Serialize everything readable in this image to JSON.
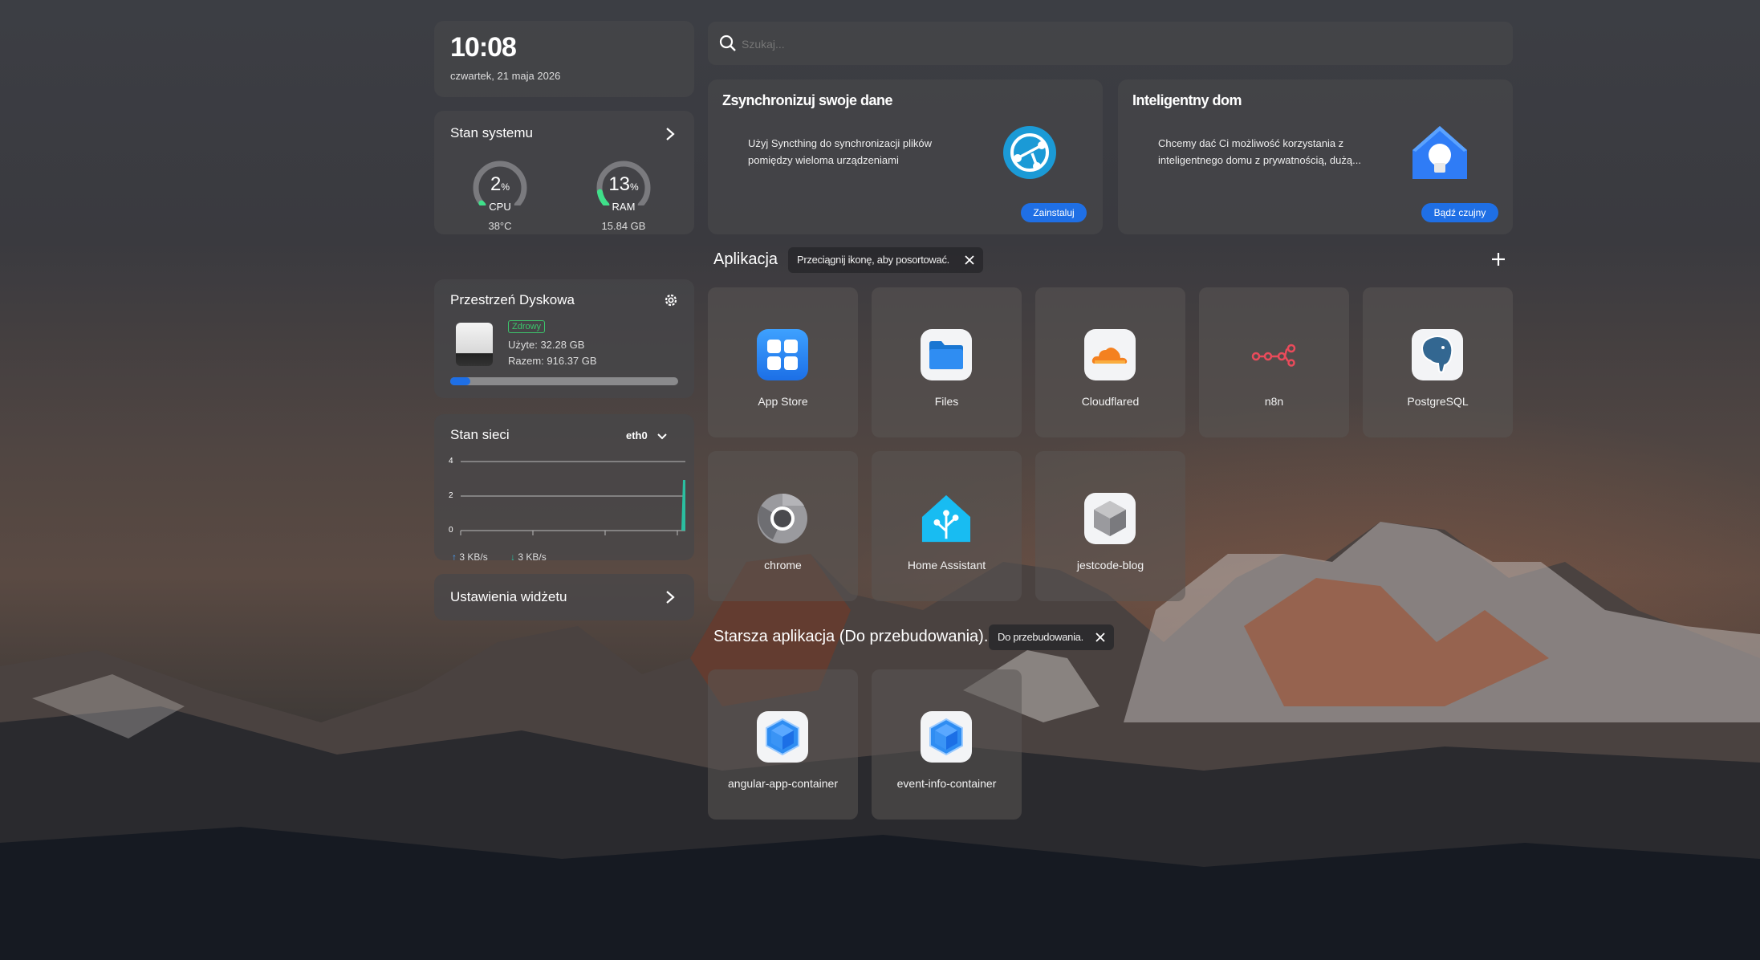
{
  "clock": {
    "time": "10:08",
    "date": "czwartek, 21 maja 2026"
  },
  "system": {
    "title": "Stan systemu",
    "cpu": {
      "value": "2",
      "unit": "%",
      "label": "CPU",
      "sub": "38°C",
      "level": 0.02
    },
    "ram": {
      "value": "13",
      "unit": "%",
      "label": "RAM",
      "sub": "15.84 GB",
      "level": 0.13
    }
  },
  "disk": {
    "title": "Przestrzeń Dyskowa",
    "status": "Zdrowy",
    "used": "Użyte: 32.28 GB",
    "total": "Razem: 916.37 GB",
    "usage": 0.035
  },
  "network": {
    "title": "Stan sieci",
    "interface": "eth0",
    "ticks": [
      "4",
      "2",
      "0"
    ],
    "upload": "3 KB/s",
    "download": "3 KB/s"
  },
  "widget_settings": {
    "label": "Ustawienia widżetu"
  },
  "search": {
    "placeholder": "Szukaj..."
  },
  "promo": [
    {
      "title": "Zsynchronizuj swoje dane",
      "text1": "Użyj Syncthing do synchronizacji plików",
      "text2": "pomiędzy wieloma urządzeniami",
      "button": "Zainstaluj"
    },
    {
      "title": "Inteligentny dom",
      "text1": "Chcemy dać Ci możliwość korzystania z",
      "text2": "inteligentnego domu z prywatnością, dużą...",
      "button": "Bądź czujny"
    }
  ],
  "apps_section": {
    "title": "Aplikacja",
    "hint": "Przeciągnij ikonę, aby posortować."
  },
  "apps": [
    {
      "name": "App Store"
    },
    {
      "name": "Files"
    },
    {
      "name": "Cloudflared"
    },
    {
      "name": "n8n"
    },
    {
      "name": "PostgreSQL"
    },
    {
      "name": "chrome"
    },
    {
      "name": "Home Assistant"
    },
    {
      "name": "jestcode-blog"
    }
  ],
  "legacy_section": {
    "title": "Starsza aplikacja (Do przebudowania).",
    "hint": "Do przebudowania."
  },
  "legacy_apps": [
    {
      "name": "angular-app-container"
    },
    {
      "name": "event-info-container"
    }
  ],
  "colors": {
    "accent": "#1f6fe5",
    "gauge": "#3fe08a",
    "network": "#2bbfa0",
    "healthy": "#3cc56b"
  }
}
